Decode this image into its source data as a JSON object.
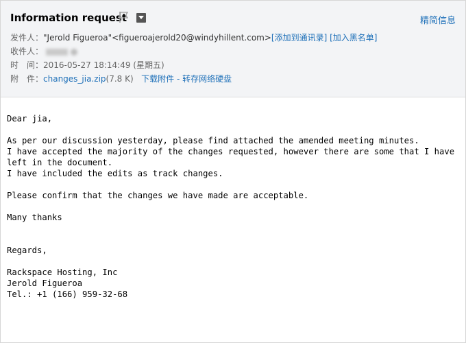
{
  "header": {
    "subject": "Information request",
    "simple_view_link": "精简信息",
    "from": {
      "label": "发件人：",
      "name": "\"Jerold Figueroa\"",
      "email": "<figueroajerold20@windyhillent.com>",
      "add_contact": "[添加到通讯录]",
      "blacklist": "[加入黑名单]"
    },
    "to": {
      "label": "收件人："
    },
    "time": {
      "label": "时　间：",
      "value": "2016-05-27 18:14:49 (星期五)"
    },
    "attachment": {
      "label": "附　件：",
      "filename": "changes_jia.zip",
      "size": "(7.8 K)",
      "download": "下载附件",
      "separator": " - ",
      "save_to_disk": "转存网络硬盘"
    },
    "icons": {
      "flag": "flag-icon",
      "menu": "chevron-down-icon"
    }
  },
  "body": {
    "lines": [
      "Dear jia,",
      "",
      "As per our discussion yesterday, please find attached the amended meeting minutes.",
      "I have accepted the majority of the changes requested, however there are some that I have",
      "left in the document.",
      "I have included the edits as track changes.",
      "",
      "Please confirm that the changes we have made are acceptable.",
      "",
      "Many thanks",
      "",
      "",
      "Regards,",
      "",
      "Rackspace Hosting, Inc",
      "Jerold Figueroa",
      "Tel.: +1 (166) 959-32-68"
    ]
  },
  "colors": {
    "link": "#1d6fb8",
    "header_bg": "#f3f4f6",
    "border": "#d6d6d6"
  }
}
